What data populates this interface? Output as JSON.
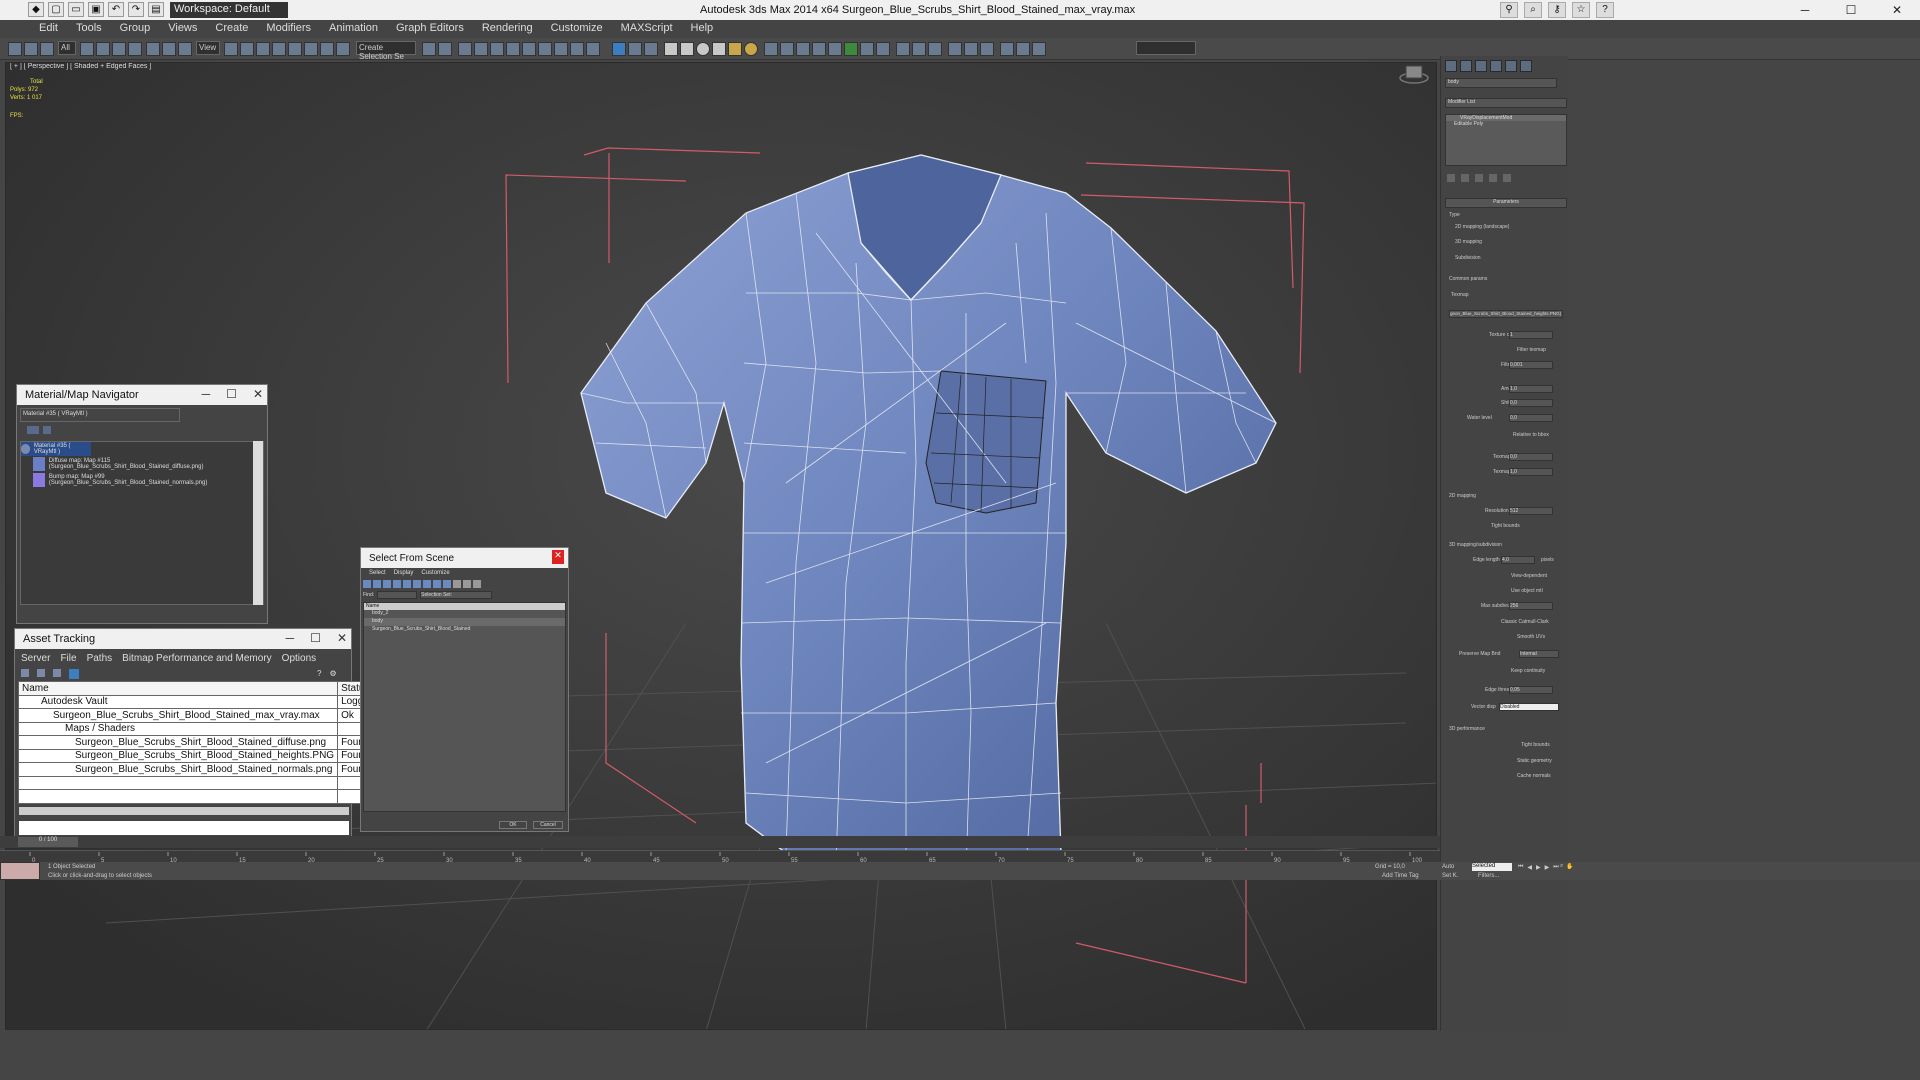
{
  "titlebar": {
    "title": "Autodesk 3ds Max  2014 x64    Surgeon_Blue_Scrubs_Shirt_Blood_Stained_max_vray.max",
    "workspace": "Workspace: Default",
    "min": "─",
    "max": "☐",
    "close": "✕"
  },
  "menu": [
    "Edit",
    "Tools",
    "Group",
    "Views",
    "Create",
    "Modifiers",
    "Animation",
    "Graph Editors",
    "Rendering",
    "Customize",
    "MAXScript",
    "Help"
  ],
  "toolbar": {
    "filter": "All",
    "view": "View",
    "selset": "Create Selection Se"
  },
  "viewport": {
    "label": "[ + ] [ Perspective ] [ Shaded + Edged Faces ]",
    "stats_total": "Total",
    "stats_polys": "Polys:  972",
    "stats_verts": "Verts:  1 017",
    "fps": "FPS:"
  },
  "cmd": {
    "object": "body",
    "modlist": "Modifier List",
    "stack": [
      "VRayDisplacementMod",
      "Editable Poly"
    ],
    "rollout": "Parameters",
    "type_label": "Type",
    "types": [
      "2D mapping (landscape)",
      "3D mapping",
      "Subdivision"
    ],
    "common": "Common params",
    "texmap": "Texmap",
    "texmap_value": "geon_Blue_Scrubs_Shirt_Blood_Stained_heights.PNG)",
    "params": [
      {
        "l": "Texture chan",
        "v": "1"
      },
      {
        "l": "Filter texmap",
        "v": ""
      },
      {
        "l": "Filter blur",
        "v": "0,001"
      },
      {
        "l": "Amount",
        "v": "1,0"
      },
      {
        "l": "Shift",
        "v": "0,0"
      },
      {
        "l": "Water level",
        "v": "0,0"
      },
      {
        "l": "Relative to bbox",
        "v": ""
      },
      {
        "l": "Texmap min",
        "v": "0,0"
      },
      {
        "l": "Texmap max",
        "v": "1,0"
      }
    ],
    "sec2d": "2D mapping",
    "resolution": "Resolution",
    "resolution_v": "512",
    "tight": "Tight bounds",
    "sec3d": "3D mapping/subdivision",
    "params3d": [
      {
        "l": "Edge length",
        "v": "4,0"
      },
      {
        "l": "View-dependent",
        "v": ""
      },
      {
        "l": "Use object mtl",
        "v": ""
      },
      {
        "l": "Max subdivs",
        "v": "256"
      },
      {
        "l": "Classic Catmull-Clark",
        "v": ""
      },
      {
        "l": "Smooth UVs",
        "v": ""
      },
      {
        "l": "Preserve Map Bnd",
        "v": "Internal"
      },
      {
        "l": "Keep continuity",
        "v": ""
      },
      {
        "l": "Edge thresh",
        "v": "0,05"
      },
      {
        "l": "Vector disp",
        "v": "Disabled"
      }
    ],
    "pixels": "pixels",
    "perf": "3D performance",
    "perf_items": [
      "Tight bounds",
      "Static geometry",
      "Cache normals"
    ]
  },
  "matnav": {
    "title": "Material/Map Navigator",
    "field": "Material #35  ( VRayMtl )",
    "items": [
      "Material #35  ( VRayMtl )",
      "Diffuse map: Map #115 (Surgeon_Blue_Scrubs_Shirt_Blood_Stained_diffuse.png)",
      "Bump map: Map #99 (Surgeon_Blue_Scrubs_Shirt_Blood_Stained_normals.png)"
    ]
  },
  "assets": {
    "title": "Asset Tracking",
    "menu": [
      "Server",
      "File",
      "Paths",
      "Bitmap Performance and Memory",
      "Options"
    ],
    "col_name": "Name",
    "col_status": "Status",
    "rows": [
      {
        "name": "Autodesk Vault",
        "status": "Logged Out (Asset"
      },
      {
        "name": "Surgeon_Blue_Scrubs_Shirt_Blood_Stained_max_vray.max",
        "status": "Ok"
      },
      {
        "name": "Maps / Shaders",
        "status": ""
      },
      {
        "name": "Surgeon_Blue_Scrubs_Shirt_Blood_Stained_diffuse.png",
        "status": "Found"
      },
      {
        "name": "Surgeon_Blue_Scrubs_Shirt_Blood_Stained_heights.PNG",
        "status": "Found"
      },
      {
        "name": "Surgeon_Blue_Scrubs_Shirt_Blood_Stained_normals.png",
        "status": "Found"
      }
    ]
  },
  "scene": {
    "title": "Select From Scene",
    "menu": [
      "Select",
      "Display",
      "Customize"
    ],
    "find": "Find:",
    "selset": "Selection Set:",
    "col_name": "Name",
    "items": [
      "body_2",
      "body",
      "Surgeon_Blue_Scrubs_Shirt_Blood_Stained"
    ],
    "ok": "OK",
    "cancel": "Cancel"
  },
  "timeline": {
    "frame": "0 / 100",
    "ticks": [
      "0",
      "5",
      "10",
      "15",
      "20",
      "25",
      "30",
      "35",
      "40",
      "45",
      "50",
      "55",
      "60",
      "65",
      "70",
      "75",
      "80",
      "85",
      "90",
      "95",
      "100"
    ]
  },
  "status": {
    "selected": "1 Object Selected",
    "prompt": "Click or click-and-drag to select objects",
    "grid": "Grid = 10,0",
    "addtime": "Add Time Tag",
    "autokey": "Auto",
    "setkey": "Set K.",
    "selmode": "Selected",
    "filters": "Filters..."
  },
  "colors": {
    "shirt": "#6f86bb",
    "wire": "#e8ecf4",
    "bbox": "#d25b6a"
  }
}
